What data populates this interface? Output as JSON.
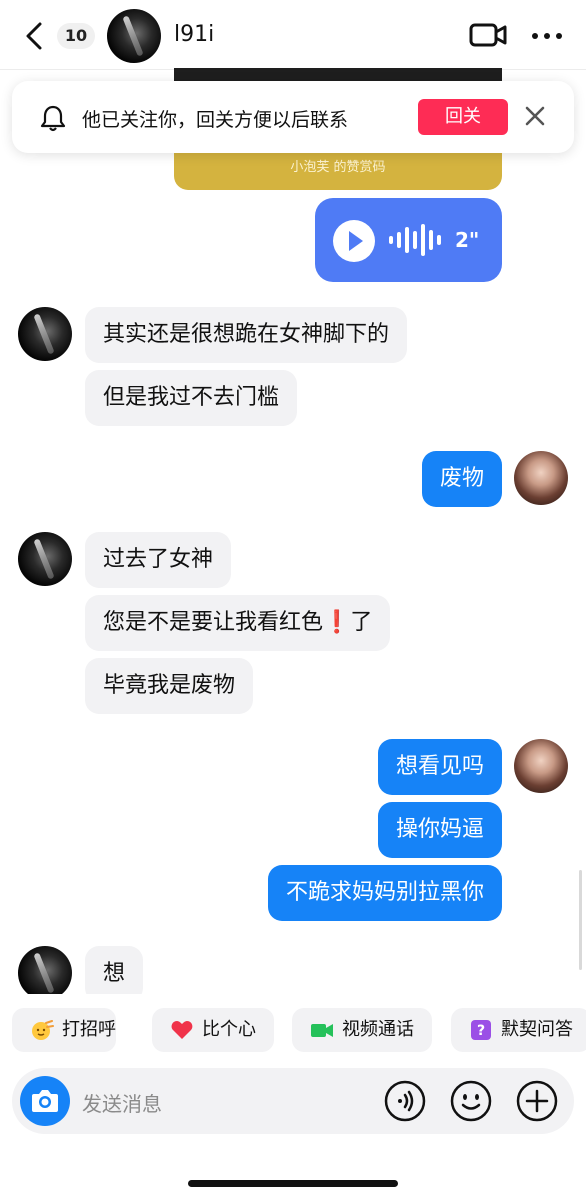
{
  "header": {
    "unread_count": "10",
    "contact_name": "l91i"
  },
  "pinned_card": {
    "caption": "小泡芙 的赞赏码"
  },
  "follow_banner": {
    "text": "他已关注你，回关方便以后联系",
    "follow_back_label": "回关"
  },
  "voice_message": {
    "duration": "2\""
  },
  "messages": [
    {
      "side": "in",
      "text": "其实还是很想跪在女神脚下的"
    },
    {
      "side": "in",
      "text": "但是我过不去门槛"
    },
    {
      "side": "out",
      "text": "废物"
    },
    {
      "side": "in",
      "text": "过去了女神"
    },
    {
      "side": "in",
      "text_before": "您是不是要让我看红色",
      "emoji": "❗",
      "text_after": "了"
    },
    {
      "side": "in",
      "text": "毕竟我是废物"
    },
    {
      "side": "out",
      "text": "想看见吗"
    },
    {
      "side": "out",
      "text": "操你妈逼"
    },
    {
      "side": "out",
      "text": "不跪求妈妈别拉黑你"
    },
    {
      "side": "in",
      "text": "想"
    }
  ],
  "quick_replies": [
    {
      "label": "打招呼",
      "icon": "wave-emoji-icon"
    },
    {
      "label": "比个心",
      "icon": "heart-icon"
    },
    {
      "label": "视频通话",
      "icon": "video-camera-icon"
    },
    {
      "label": "默契问答",
      "icon": "question-icon"
    }
  ],
  "input": {
    "placeholder": "发送消息"
  },
  "colors": {
    "accent_blue": "#1683f7",
    "voice_blue": "#4f7bf5",
    "follow_red": "#fe2c55"
  }
}
